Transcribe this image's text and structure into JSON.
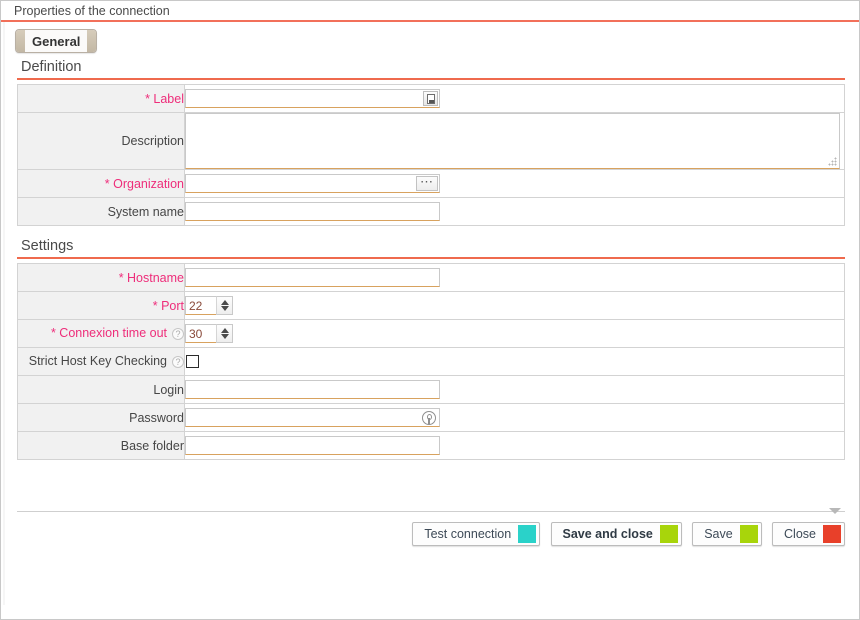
{
  "window": {
    "title": "Properties of the connection"
  },
  "tabs": [
    {
      "label": "General",
      "active": true
    }
  ],
  "sections": {
    "definition": {
      "title": "Definition",
      "rows": [
        {
          "label": "* Label",
          "required": true,
          "help": false,
          "value": "",
          "control": "text-with-translate"
        },
        {
          "label": "Description",
          "required": false,
          "help": false,
          "value": "",
          "control": "textarea"
        },
        {
          "label": "* Organization",
          "required": true,
          "help": false,
          "value": "",
          "control": "text-with-browse"
        },
        {
          "label": "System name",
          "required": false,
          "help": false,
          "value": "",
          "control": "text"
        }
      ]
    },
    "settings": {
      "title": "Settings",
      "rows": [
        {
          "label": "* Hostname",
          "required": true,
          "help": false,
          "value": "",
          "control": "text"
        },
        {
          "label": "* Port",
          "required": true,
          "help": false,
          "value": "22",
          "control": "spinner"
        },
        {
          "label": "* Connexion time out",
          "required": true,
          "help": true,
          "value": "30",
          "control": "spinner"
        },
        {
          "label": "Strict Host Key Checking",
          "required": false,
          "help": true,
          "value": "",
          "control": "checkbox",
          "checked": false
        },
        {
          "label": "Login",
          "required": false,
          "help": false,
          "value": "",
          "control": "text"
        },
        {
          "label": "Password",
          "required": false,
          "help": false,
          "value": "",
          "control": "password"
        },
        {
          "label": "Base folder",
          "required": false,
          "help": false,
          "value": "",
          "control": "text"
        }
      ]
    }
  },
  "icons": {
    "translate": "translate-icon",
    "browse": "ellipsis-icon",
    "password_key": "key-icon",
    "help": "?",
    "collapse": "chevron-down-icon",
    "resize_grip": "resize-grip-icon"
  },
  "footer": {
    "buttons": [
      {
        "label": "Test connection",
        "color": "#2ad2c9",
        "strong": false
      },
      {
        "label": "Save and close",
        "color": "#a8d50b",
        "strong": true
      },
      {
        "label": "Save",
        "color": "#a8d50b",
        "strong": false
      },
      {
        "label": "Close",
        "color": "#e8402a",
        "strong": false
      }
    ]
  },
  "theme": {
    "title_rule": "#f2705a",
    "section_rule": "#ef6a4d",
    "required_label": "#ee2d7a",
    "label_cell_bg": "#f1f1f1",
    "input_underline": "#d8a25e",
    "field_text": "#8a4a3a"
  }
}
